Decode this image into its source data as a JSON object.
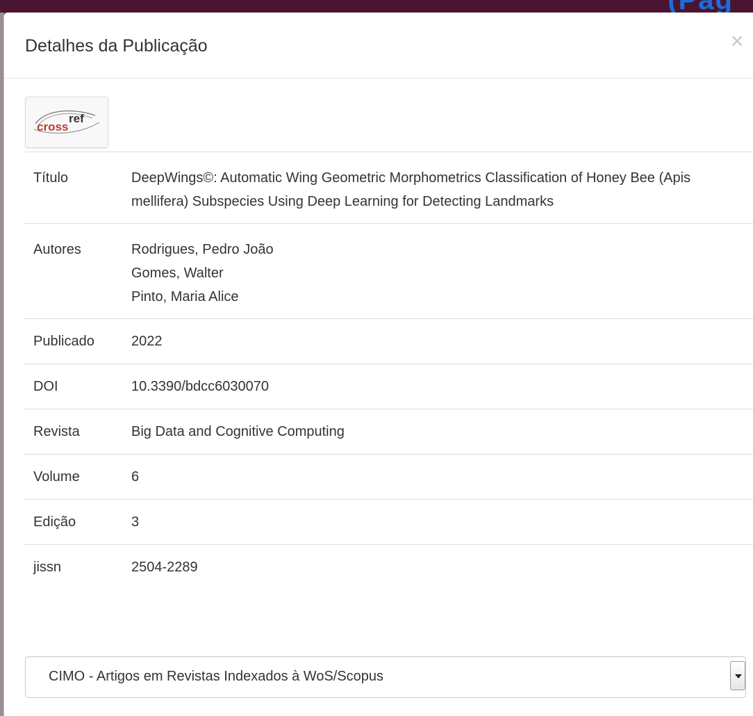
{
  "background": {
    "link_text": "(Pág"
  },
  "modal": {
    "title": "Detalhes da Publicação",
    "close_label": "×",
    "logo_text": "crossref"
  },
  "details": {
    "title_label": "Título",
    "title_value": "DeepWings©: Automatic Wing Geometric Morphometrics Classification of Honey Bee (Apis mellifera) Subspecies Using Deep Learning for Detecting Landmarks",
    "authors_label": "Autores",
    "authors": [
      "Rodrigues, Pedro João",
      "Gomes, Walter",
      "Pinto, Maria Alice"
    ],
    "published_label": "Publicado",
    "published_value": "2022",
    "doi_label": "DOI",
    "doi_value": "10.3390/bdcc6030070",
    "journal_label": "Revista",
    "journal_value": "Big Data and Cognitive Computing",
    "volume_label": "Volume",
    "volume_value": "6",
    "issue_label": "Edição",
    "issue_value": "3",
    "jissn_label": "jissn",
    "jissn_value": "2504-2289"
  },
  "select": {
    "selected": "CIMO - Artigos em Revistas Indexados à WoS/Scopus"
  },
  "colors": {
    "background": "#4a1530",
    "link": "#1a6fe0",
    "text": "#333333",
    "crossref_red": "#c0392b"
  }
}
